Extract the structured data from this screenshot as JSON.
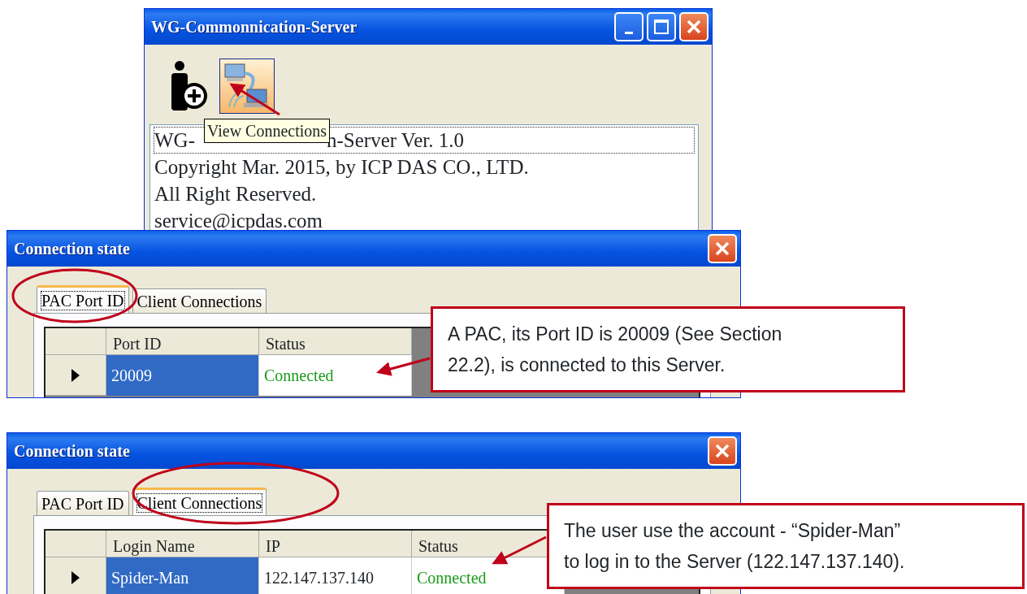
{
  "main_window": {
    "title": "WG-Commonnication-Server",
    "toolbar": [
      {
        "kind": "add-user",
        "selected": false
      },
      {
        "kind": "connections",
        "selected": true
      }
    ],
    "tooltip": "View Connections",
    "info_lines": [
      {
        "parts": [
          "WG-",
          "n-Server Ver. 1.0"
        ],
        "focused": true
      },
      {
        "parts": [
          "Copyright Mar. 2015, by ICP DAS CO., LTD."
        ],
        "focused": false
      },
      {
        "parts": [
          "All Right Reserved."
        ],
        "focused": false
      },
      {
        "parts": [
          "service@icpdas.com"
        ],
        "focused": false
      }
    ]
  },
  "dialogs": [
    {
      "title": "Connection state",
      "tabs": [
        {
          "label": "PAC Port ID",
          "selected": true
        },
        {
          "label": "Client Connections",
          "selected": false
        }
      ],
      "columns": [
        "Port ID",
        "Status"
      ],
      "rows": [
        {
          "cells": [
            "20009",
            "Connected"
          ],
          "selected": true
        }
      ],
      "annotation": {
        "lines": [
          "A PAC, its Port ID is 20009 (See Section",
          "22.2), is connected to this Server."
        ]
      }
    },
    {
      "title": "Connection state",
      "tabs": [
        {
          "label": "PAC Port ID",
          "selected": false
        },
        {
          "label": "Client Connections",
          "selected": true
        }
      ],
      "columns": [
        "Login Name",
        "IP",
        "Status"
      ],
      "rows": [
        {
          "cells": [
            "Spider-Man",
            "122.147.137.140",
            "Connected"
          ],
          "selected": true
        }
      ],
      "annotation": {
        "lines": [
          "The user use the account - “Spider-Man”",
          "to log in to the Server (122.147.137.140)."
        ]
      }
    }
  ]
}
